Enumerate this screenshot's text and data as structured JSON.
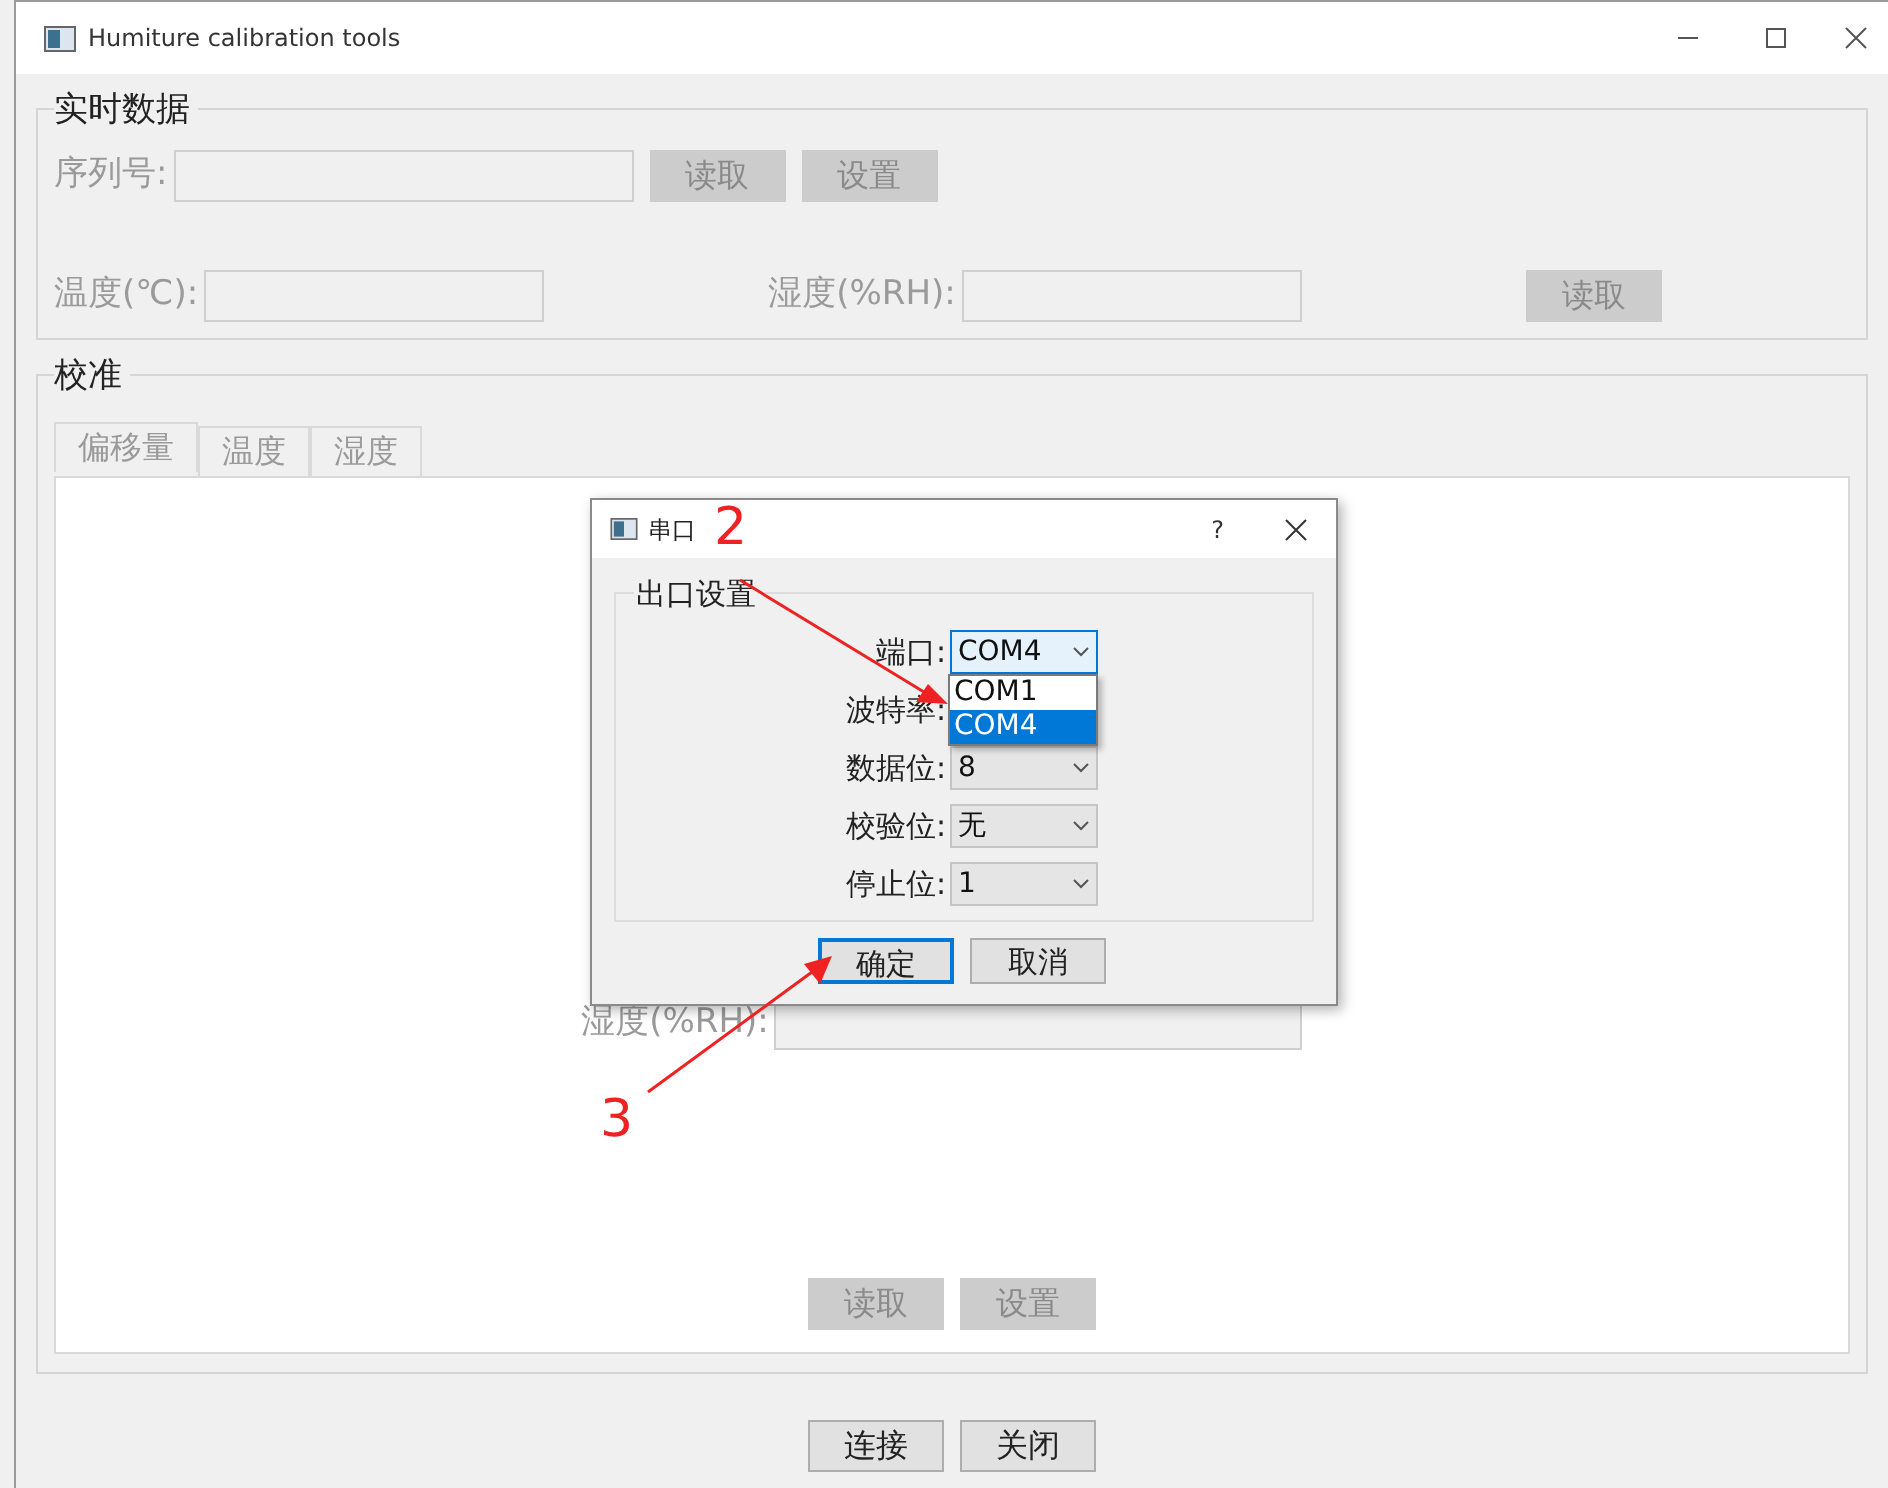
{
  "window": {
    "title": "Humiture calibration tools"
  },
  "realtime": {
    "title": "实时数据",
    "serial": {
      "label": "序列号:",
      "disabled": true
    },
    "serial_buttons": [
      {
        "label": "读取",
        "disabled": true
      },
      {
        "label": "设置",
        "disabled": true
      }
    ],
    "temperature": {
      "label": "温度(℃):",
      "disabled": true
    },
    "humidity": {
      "label": "湿度(%RH):",
      "disabled": true
    },
    "read_button": {
      "label": "读取",
      "disabled": true
    }
  },
  "calibration": {
    "title": "校准",
    "tabs": [
      {
        "label": "偏移量",
        "selected": true
      },
      {
        "label": "温度",
        "selected": false
      },
      {
        "label": "湿度",
        "selected": false
      }
    ],
    "humidity": {
      "label": "湿度(%RH):",
      "disabled": true
    },
    "buttons": [
      {
        "label": "读取",
        "disabled": true
      },
      {
        "label": "设置",
        "disabled": true
      }
    ]
  },
  "buttons": [
    {
      "label": "连接",
      "disabled": false
    },
    {
      "label": "关闭",
      "disabled": false
    }
  ],
  "dialog": {
    "title": "串口",
    "help": "?",
    "group": "出口设置",
    "rows": [
      {
        "label": "端口:",
        "value": "COM4",
        "focused": true
      },
      {
        "label": "波特率:"
      },
      {
        "label": "数据位:",
        "value": "8",
        "focused": false
      },
      {
        "label": "校验位:",
        "value": "无",
        "focused": false
      },
      {
        "label": "停止位:",
        "value": "1",
        "focused": false
      }
    ],
    "dropdown": [
      {
        "label": "COM1",
        "selected": false
      },
      {
        "label": "COM4",
        "selected": true
      }
    ],
    "buttons": [
      {
        "label": "确定",
        "default": true
      },
      {
        "label": "取消",
        "default": false
      }
    ]
  },
  "annotations": [
    {
      "label": "2"
    },
    {
      "label": "3"
    }
  ]
}
